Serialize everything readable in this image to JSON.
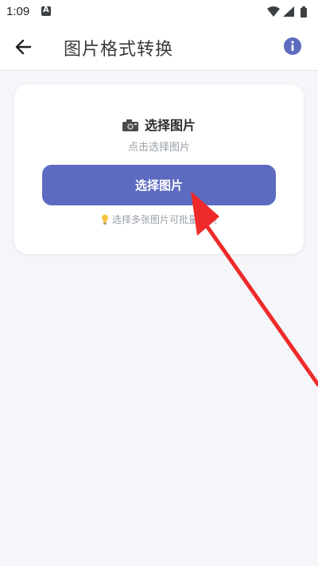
{
  "status_bar": {
    "time": "1:09",
    "icons": [
      "a-icon",
      "wifi-icon",
      "signal-icon",
      "battery-icon"
    ]
  },
  "app_bar": {
    "title": "图片格式转换",
    "back_icon": "arrow-left-icon",
    "info_icon": "info-icon"
  },
  "card": {
    "header": "选择图片",
    "header_icon": "camera-icon",
    "subtitle": "点击选择图片",
    "button_label": "选择图片",
    "tip": "选择多张图片可批量转换",
    "tip_icon": "lightbulb-icon"
  },
  "colors": {
    "accent": "#5c6bc0",
    "background": "#f5f6fa",
    "annotation_arrow": "#ee2a2a"
  }
}
